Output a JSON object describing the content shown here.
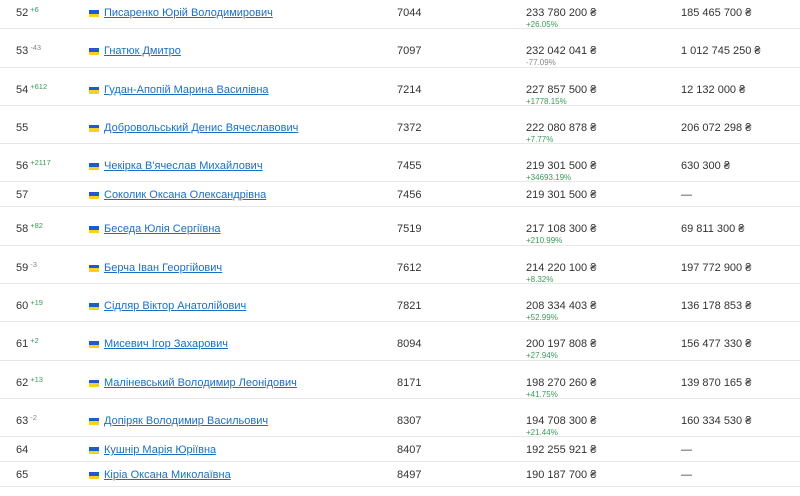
{
  "colors": {
    "link": "#1a6fc2",
    "positive": "#3a9b5a",
    "negative": "#888888",
    "flag_blue": "#1f5bc6",
    "flag_yellow": "#f6d21c"
  },
  "rows": [
    {
      "rank": "52",
      "change": "+6",
      "change_dir": "up",
      "name": "Писаренко Юрій Володимирович",
      "number": "7044",
      "amount": "233 780 200 ₴",
      "pct": "+26.05%",
      "pct_dir": "up",
      "amount2": "185 465 700 ₴",
      "tall": true
    },
    {
      "rank": "53",
      "change": "-43",
      "change_dir": "down",
      "name": "Гнатюк Дмитро",
      "number": "7097",
      "amount": "232 042 041 ₴",
      "pct": "-77.09%",
      "pct_dir": "down",
      "amount2": "1 012 745 250 ₴",
      "tall": true
    },
    {
      "rank": "54",
      "change": "+612",
      "change_dir": "up",
      "name": "Гудан-Апопій Марина Василівна",
      "number": "7214",
      "amount": "227 857 500 ₴",
      "pct": "+1778.15%",
      "pct_dir": "up",
      "amount2": "12 132 000 ₴",
      "tall": true
    },
    {
      "rank": "55",
      "change": "",
      "change_dir": "up",
      "name": "Добровольський Денис Вячеславович",
      "number": "7372",
      "amount": "222 080 878 ₴",
      "pct": "+7.77%",
      "pct_dir": "up",
      "amount2": "206 072 298 ₴",
      "tall": true
    },
    {
      "rank": "56",
      "change": "+2117",
      "change_dir": "up",
      "name": "Чекірка В'ячеслав Михайлович",
      "number": "7455",
      "amount": "219 301 500 ₴",
      "pct": "+34693.19%",
      "pct_dir": "up",
      "amount2": "630 300 ₴",
      "tall": true
    },
    {
      "rank": "57",
      "change": "",
      "change_dir": "up",
      "name": "Соколик Оксана Олександрівна",
      "number": "7456",
      "amount": "219 301 500 ₴",
      "pct": "",
      "pct_dir": "up",
      "amount2": "—",
      "tall": false
    },
    {
      "rank": "58",
      "change": "+82",
      "change_dir": "up",
      "name": "Беседа Юлія Сергіївна",
      "number": "7519",
      "amount": "217 108 300 ₴",
      "pct": "+210.99%",
      "pct_dir": "up",
      "amount2": "69 811 300 ₴",
      "tall": true
    },
    {
      "rank": "59",
      "change": "-3",
      "change_dir": "down",
      "name": "Берча Іван Георгійович",
      "number": "7612",
      "amount": "214 220 100 ₴",
      "pct": "+8.32%",
      "pct_dir": "up",
      "amount2": "197 772 900 ₴",
      "tall": true
    },
    {
      "rank": "60",
      "change": "+19",
      "change_dir": "up",
      "name": "Сідляр Віктор Анатолійович",
      "number": "7821",
      "amount": "208 334 403 ₴",
      "pct": "+52.99%",
      "pct_dir": "up",
      "amount2": "136 178 853 ₴",
      "tall": true
    },
    {
      "rank": "61",
      "change": "+2",
      "change_dir": "up",
      "name": "Мисевич Ігор Захарович",
      "number": "8094",
      "amount": "200 197 808 ₴",
      "pct": "+27.94%",
      "pct_dir": "up",
      "amount2": "156 477 330 ₴",
      "tall": true
    },
    {
      "rank": "62",
      "change": "+13",
      "change_dir": "up",
      "name": "Малінevський Володимир Леонідович",
      "number": "8171",
      "amount": "198 270 260 ₴",
      "pct": "+41.75%",
      "pct_dir": "up",
      "amount2": "139 870 165 ₴",
      "tall": true
    },
    {
      "rank": "63",
      "change": "-2",
      "change_dir": "down",
      "name": "Доп'ряк Володимир Васильович",
      "number": "8307",
      "amount": "194 708 300 ₴",
      "pct": "+21.44%",
      "pct_dir": "up",
      "amount2": "160 334 530 ₴",
      "tall": true
    },
    {
      "rank": "64",
      "change": "",
      "change_dir": "up",
      "name": "Кушнір Марія Юріївна",
      "number": "8407",
      "amount": "192 255 921 ₴",
      "pct": "",
      "pct_dir": "up",
      "amount2": "—",
      "tall": false
    },
    {
      "rank": "65",
      "change": "",
      "change_dir": "up",
      "name": "Кіріа Оксана Миколаївна",
      "number": "8497",
      "amount": "190 187 700 ₴",
      "pct": "",
      "pct_dir": "up",
      "amount2": "—",
      "tall": false
    }
  ]
}
